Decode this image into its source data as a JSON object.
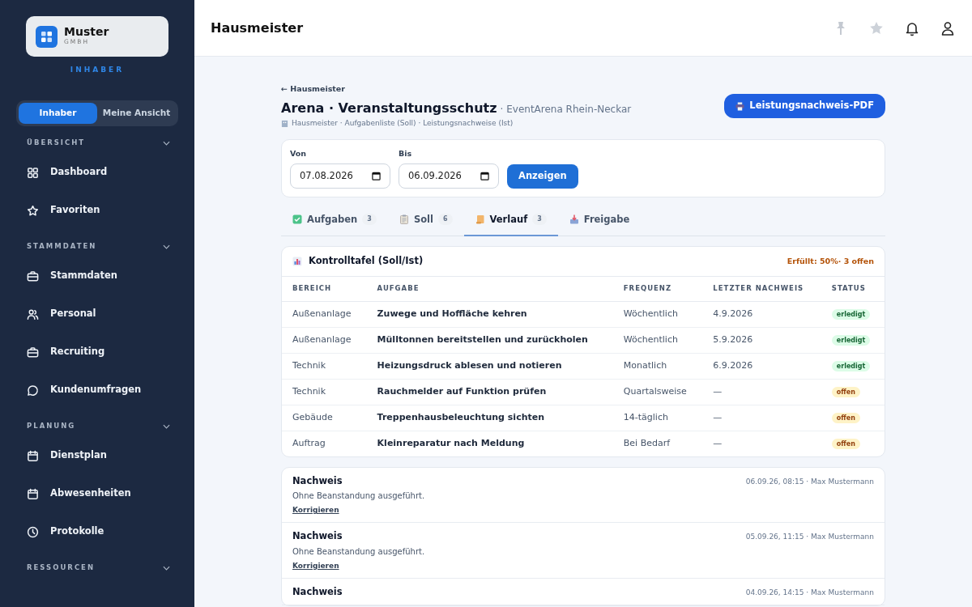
{
  "sidebar": {
    "logo": {
      "name": "Muster",
      "suffix": "GMBH"
    },
    "role": "INHABER",
    "view_toggle": [
      {
        "label": "Inhaber",
        "selected": true
      },
      {
        "label": "Meine Ansicht",
        "selected": false
      }
    ],
    "sections": [
      {
        "title": "ÜBERSICHT",
        "items": [
          {
            "label": "Dashboard",
            "kind": "grid"
          },
          {
            "label": "Favoriten",
            "kind": "star"
          }
        ]
      },
      {
        "title": "STAMMDATEN",
        "items": [
          {
            "label": "Stammdaten",
            "kind": "briefcase"
          },
          {
            "label": "Personal",
            "kind": "users"
          },
          {
            "label": "Recruiting",
            "kind": "briefcase"
          },
          {
            "label": "Kundenumfragen",
            "kind": "chat"
          }
        ]
      },
      {
        "title": "PLANUNG",
        "items": [
          {
            "label": "Dienstplan",
            "kind": "calendar"
          },
          {
            "label": "Abwesenheiten",
            "kind": "calendar"
          },
          {
            "label": "Protokolle",
            "kind": "clock"
          }
        ]
      },
      {
        "title": "RESSOURCEN"
      }
    ]
  },
  "header": {
    "title": "Hausmeister"
  },
  "page": {
    "back_link": "← Hausmeister",
    "title": "Arena · Veranstaltungsschutz",
    "subtitle": "· EventArena Rhein-Neckar",
    "breadcrumb": "Hausmeister · Aufgabenliste (Soll) · Leistungsnachweise (Ist)",
    "pdf_button": "Leistungsnachweis-PDF"
  },
  "filter": {
    "from": {
      "label": "Von",
      "value": "07.08.2026"
    },
    "to": {
      "label": "Bis",
      "value": "06.09.2026"
    },
    "button": "Anzeigen"
  },
  "tabs": [
    {
      "label": "Aufgaben",
      "count": "3",
      "kind": "check",
      "selected": false
    },
    {
      "label": "Soll",
      "count": "6",
      "kind": "clipboard",
      "selected": false
    },
    {
      "label": "Verlauf",
      "count": "3",
      "kind": "scroll",
      "selected": true
    },
    {
      "label": "Freigabe",
      "kind": "inbox",
      "selected": false
    }
  ],
  "table": {
    "title": "Kontrolltafel (Soll/Ist)",
    "summary": "Erfüllt: 50%· 3 offen",
    "columns": [
      "BEREICH",
      "AUFGABE",
      "FREQUENZ",
      "LETZTER NACHWEIS",
      "STATUS"
    ],
    "rows": [
      {
        "area": "Außenanlage",
        "task": "Zuwege und Hoffläche kehren",
        "frequency": "Wöchentlich",
        "last": "4.9.2026",
        "status": {
          "label": "erledigt",
          "kind": "done"
        }
      },
      {
        "area": "Außenanlage",
        "task": "Mülltonnen bereitstellen und zurückholen",
        "frequency": "Wöchentlich",
        "last": "5.9.2026",
        "status": {
          "label": "erledigt",
          "kind": "done"
        }
      },
      {
        "area": "Technik",
        "task": "Heizungsdruck ablesen und notieren",
        "frequency": "Monatlich",
        "last": "6.9.2026",
        "status": {
          "label": "erledigt",
          "kind": "done"
        }
      },
      {
        "area": "Technik",
        "task": "Rauchmelder auf Funktion prüfen",
        "frequency": "Quartalsweise",
        "last": "—",
        "status": {
          "label": "offen",
          "kind": "open"
        }
      },
      {
        "area": "Gebäude",
        "task": "Treppenhausbeleuchtung sichten",
        "frequency": "14-täglich",
        "last": "—",
        "status": {
          "label": "offen",
          "kind": "open"
        }
      },
      {
        "area": "Auftrag",
        "task": "Kleinreparatur nach Meldung",
        "frequency": "Bei Bedarf",
        "last": "—",
        "status": {
          "label": "offen",
          "kind": "open"
        }
      }
    ]
  },
  "entries": [
    {
      "title": "Nachweis",
      "meta": "06.09.26, 08:15 · Max Mustermann",
      "text": "Ohne Beanstandung ausgeführt.",
      "link": "Korrigieren"
    },
    {
      "title": "Nachweis",
      "meta": "05.09.26, 11:15 · Max Mustermann",
      "text": "Ohne Beanstandung ausgeführt.",
      "link": "Korrigieren"
    },
    {
      "title": "Nachweis",
      "meta": "04.09.26, 14:15 · Max Mustermann"
    }
  ]
}
